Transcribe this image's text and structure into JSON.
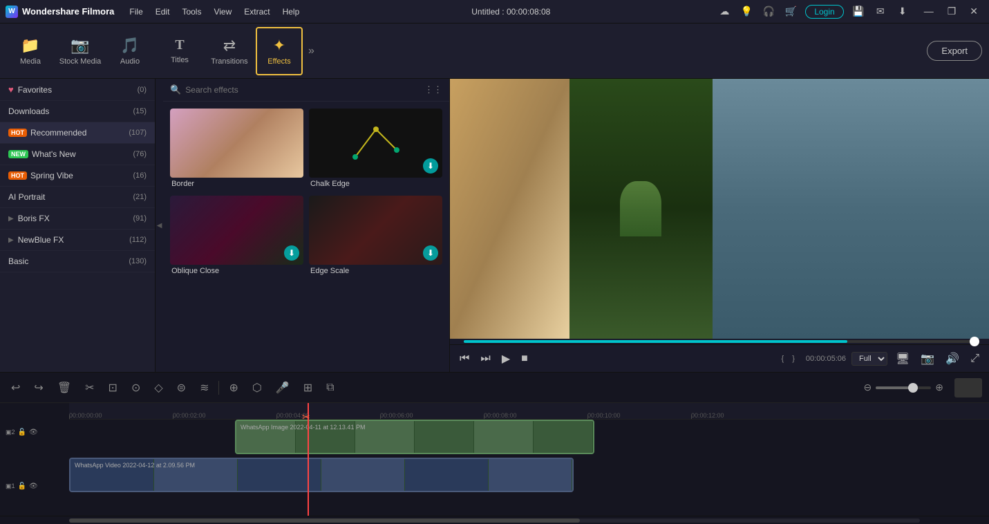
{
  "titlebar": {
    "logo_text": "Wondershare Filmora",
    "menus": [
      "File",
      "Edit",
      "Tools",
      "View",
      "Extract",
      "Help"
    ],
    "center_title": "Untitled : 00:00:08:08",
    "login_label": "Login",
    "win_min": "—",
    "win_max": "❐",
    "win_close": "✕"
  },
  "toolbar": {
    "items": [
      {
        "label": "Media",
        "icon": "📁"
      },
      {
        "label": "Stock Media",
        "icon": "📷"
      },
      {
        "label": "Audio",
        "icon": "🎵"
      },
      {
        "label": "Titles",
        "icon": "T"
      },
      {
        "label": "Transitions",
        "icon": "⇄"
      },
      {
        "label": "Effects",
        "icon": "✦"
      }
    ],
    "export_label": "Export"
  },
  "left_panel": {
    "items": [
      {
        "label": "Favorites",
        "count": "(0)",
        "badge": null,
        "heart": true
      },
      {
        "label": "Downloads",
        "count": "(15)",
        "badge": null,
        "heart": false
      },
      {
        "label": "Recommended",
        "count": "(107)",
        "badge": "HOT",
        "badge_type": "hot",
        "heart": false
      },
      {
        "label": "What's New",
        "count": "(76)",
        "badge": "NEW",
        "badge_type": "new",
        "heart": false
      },
      {
        "label": "Spring Vibe",
        "count": "(16)",
        "badge": "HOT",
        "badge_type": "hot",
        "heart": false
      },
      {
        "label": "AI Portrait",
        "count": "(21)",
        "badge": null,
        "heart": false
      },
      {
        "label": "Boris FX",
        "count": "(91)",
        "badge": null,
        "has_arrow": true,
        "heart": false
      },
      {
        "label": "NewBlue FX",
        "count": "(112)",
        "badge": null,
        "has_arrow": true,
        "heart": false
      },
      {
        "label": "Basic",
        "count": "(130)",
        "badge": null,
        "heart": false
      }
    ]
  },
  "effects_panel": {
    "search_placeholder": "Search effects",
    "effects": [
      {
        "label": "Border",
        "type": "border"
      },
      {
        "label": "Chalk Edge",
        "type": "chalk"
      },
      {
        "label": "Oblique Close",
        "type": "oblique"
      },
      {
        "label": "Edge Scale",
        "type": "edge"
      }
    ]
  },
  "preview": {
    "time_current": "00:00:05:06",
    "quality": "Full"
  },
  "timeline": {
    "tracks": [
      {
        "label": "WhatsApp Image 2022-04-11 at 12.13.41 PM",
        "type": "image"
      },
      {
        "label": "WhatsApp Video 2022-04-12 at 2.09.56 PM",
        "type": "video"
      }
    ],
    "ruler_marks": [
      {
        "time": "00:00:00:00",
        "pos": 0
      },
      {
        "time": "00:00:02:00",
        "pos": 150
      },
      {
        "time": "00:00:04:00",
        "pos": 300
      },
      {
        "time": "00:00:06:00",
        "pos": 450
      },
      {
        "time": "00:00:08:00",
        "pos": 600
      },
      {
        "time": "00:00:10:00",
        "pos": 750
      },
      {
        "time": "00:00:12:00",
        "pos": 900
      }
    ]
  }
}
